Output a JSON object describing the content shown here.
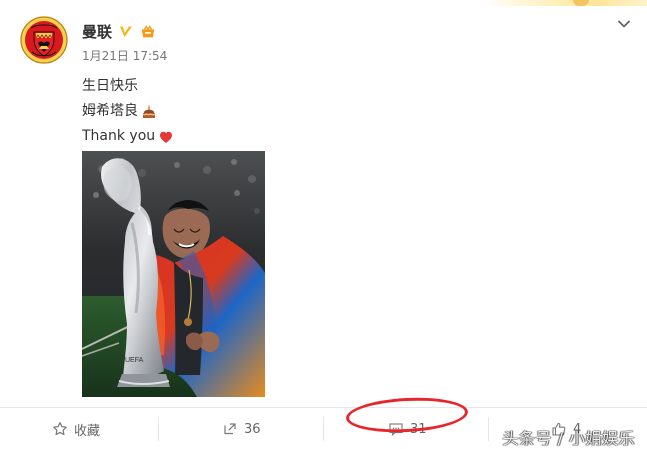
{
  "post": {
    "username": "曼联",
    "timestamp": "1月21日 17:54",
    "text_lines": [
      "生日快乐",
      "姆希塔良",
      "Thank you"
    ]
  },
  "actions": {
    "favorite_label": "收藏",
    "repost_count": "36",
    "comment_count": "31",
    "like_count": "4"
  },
  "watermark": {
    "text": "头条号 / 小娟娱乐"
  },
  "colors": {
    "accent_orange": "#f29b1b",
    "badge_gold": "#f3b718",
    "heart_red": "#e53935",
    "annotation_red": "#e7262c",
    "text_dark": "#333333",
    "text_muted": "#777777"
  },
  "icons": {
    "chevron": "chevron-down-icon",
    "verified": "verified-badge-icon",
    "level": "level-badge-icon",
    "cake": "cake-emoji-icon",
    "heart": "heart-emoji-icon",
    "favorite": "star-icon",
    "repost": "share-icon",
    "comment": "comment-icon",
    "like": "thumb-up-icon"
  }
}
